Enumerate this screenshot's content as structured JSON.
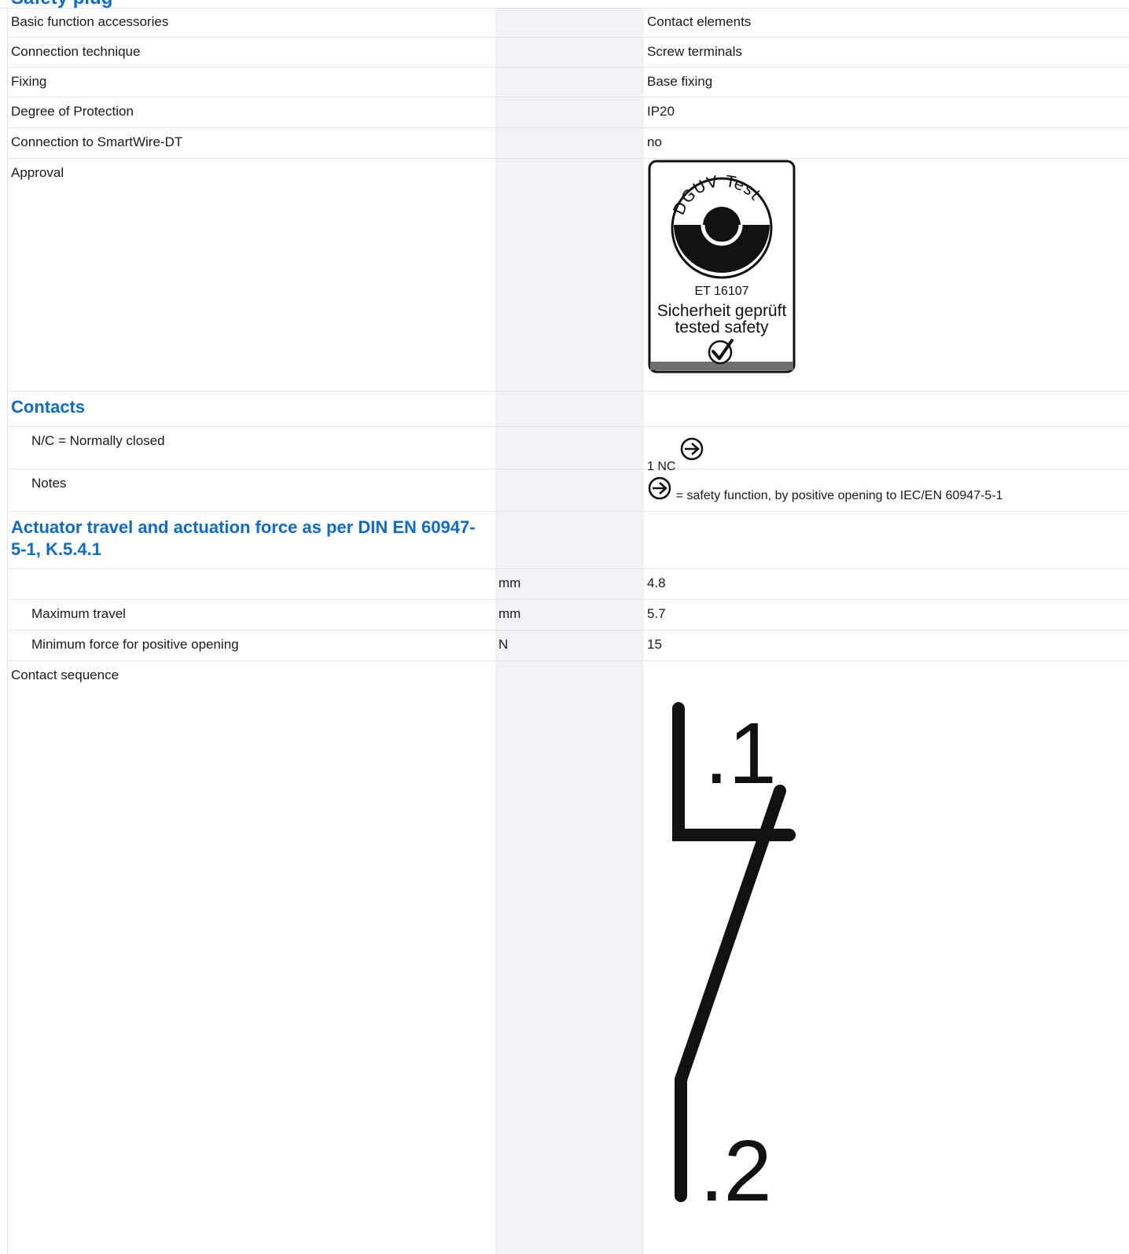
{
  "header": {
    "cut_title": "Safety plug"
  },
  "rows": {
    "basic_function": {
      "label": "Basic function accessories",
      "unit": "",
      "value": "Contact elements"
    },
    "connection_technique": {
      "label": "Connection technique",
      "unit": "",
      "value": "Screw terminals"
    },
    "fixing": {
      "label": "Fixing",
      "unit": "",
      "value": "Base fixing"
    },
    "degree_protection": {
      "label": "Degree of Protection",
      "unit": "",
      "value": "IP20"
    },
    "smartwire": {
      "label": "Connection to SmartWire-DT",
      "unit": "",
      "value": "no"
    },
    "approval": {
      "label": "Approval",
      "badge": {
        "ring_text": "DGUV Test",
        "code": "ET 16107",
        "line1": "Sicherheit geprüft",
        "line2": "tested safety"
      }
    }
  },
  "sections": {
    "contacts": {
      "title": "Contacts"
    },
    "actuator": {
      "title": "Actuator travel and actuation force as per DIN EN 60947-5-1, K.5.4.1"
    }
  },
  "contacts": {
    "nc": {
      "label": "N/C = Normally closed",
      "value": "1 NC"
    },
    "notes": {
      "label": "Notes",
      "value": "= safety function, by positive opening to IEC/EN 60947-5-1"
    }
  },
  "actuator": {
    "travel_blank": {
      "label": "",
      "unit": "mm",
      "value": "4.8"
    },
    "max_travel": {
      "label": "Maximum travel",
      "unit": "mm",
      "value": "5.7"
    },
    "min_force": {
      "label": "Minimum force for positive opening",
      "unit": "N",
      "value": "15"
    }
  },
  "contact_sequence": {
    "label": "Contact sequence",
    "terminal_top": ".1",
    "terminal_bottom": ".2"
  },
  "colors": {
    "accent": "#0d6bd0",
    "unit_column_bg": "#f1f2f6",
    "row_border": "#e6e6e6"
  }
}
